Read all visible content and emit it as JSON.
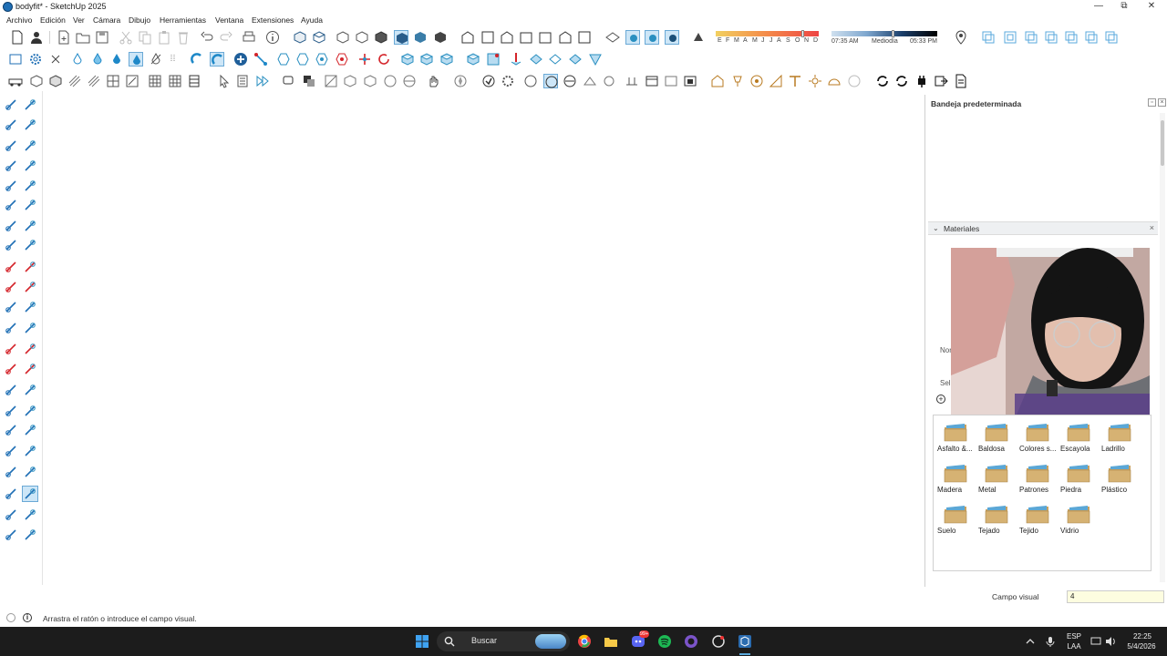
{
  "window": {
    "title": "bodyfit* - SketchUp 2025",
    "minimize_glyph": "—",
    "maximize_glyph": "⧉",
    "close_glyph": "✕"
  },
  "menu": [
    "Archivo",
    "Edición",
    "Ver",
    "Cámara",
    "Dibujo",
    "Herramientas",
    "Ventana",
    "Extensiones",
    "Ayuda"
  ],
  "shadow": {
    "months": [
      "E",
      "F",
      "M",
      "A",
      "M",
      "J",
      "J",
      "A",
      "S",
      "O",
      "N",
      "D"
    ],
    "time_start": "07:35 AM",
    "time_mid": "Mediodía",
    "time_end": "05:33 PM"
  },
  "tray": {
    "title": "Bandeja predeterminada",
    "materials_title": "Materiales",
    "partial_nombre": "Nor",
    "partial_sel": "Sel",
    "materials": [
      {
        "name": "Asfalto &..."
      },
      {
        "name": "Baldosa"
      },
      {
        "name": "Colores s..."
      },
      {
        "name": "Escayola"
      },
      {
        "name": "Ladrillo"
      },
      {
        "name": "Madera"
      },
      {
        "name": "Metal"
      },
      {
        "name": "Patrones"
      },
      {
        "name": "Piedra"
      },
      {
        "name": "Plástico"
      },
      {
        "name": "Suelo"
      },
      {
        "name": "Tejado"
      },
      {
        "name": "Tejido"
      },
      {
        "name": "Vidrio"
      }
    ]
  },
  "vcb": {
    "label": "Campo visual",
    "value": "4"
  },
  "status": {
    "message": "Arrastra el ratón o introduce el campo visual."
  },
  "taskbar": {
    "search_label": "Buscar",
    "lang_top": "ESP",
    "lang_bottom": "LAA",
    "time": "22:25",
    "date": "5/4/2026",
    "badge": "99+"
  },
  "colors": {
    "accent": "#1e88c8",
    "icon_teal": "#2a8fc0",
    "icon_red": "#d4242a",
    "folder": "#c9a15f",
    "taskbar_bg": "#1c1c1c"
  }
}
